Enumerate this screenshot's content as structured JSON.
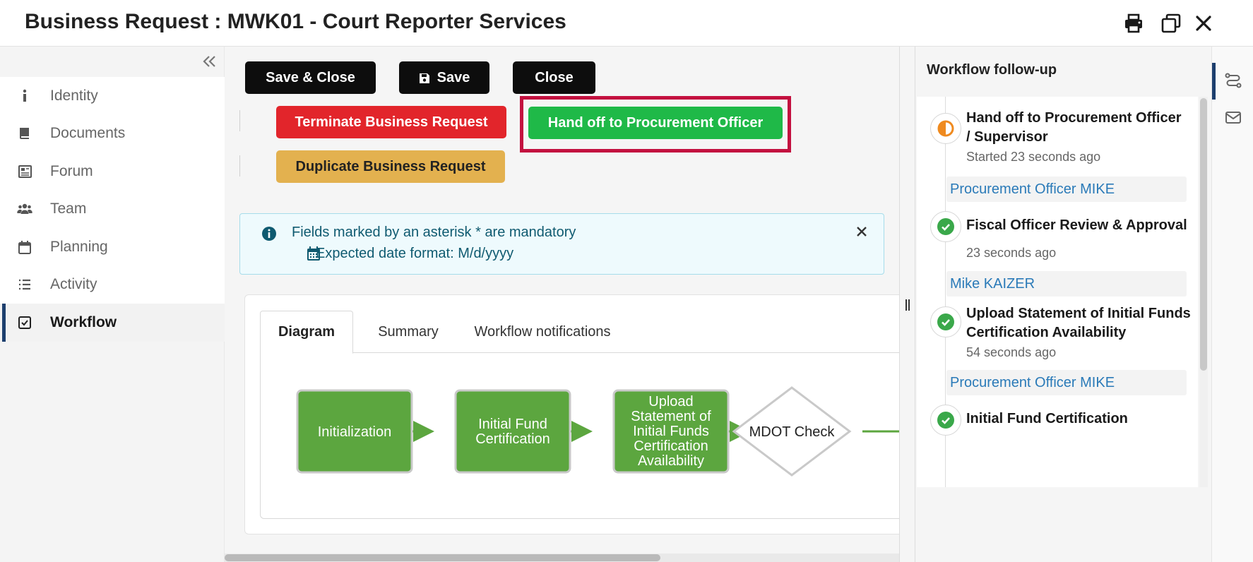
{
  "window": {
    "title": "Business Request : MWK01 - Court Reporter Services"
  },
  "sidebar": {
    "items": [
      {
        "label": "Identity",
        "icon": "info-icon"
      },
      {
        "label": "Documents",
        "icon": "book-icon"
      },
      {
        "label": "Forum",
        "icon": "newspaper-icon"
      },
      {
        "label": "Team",
        "icon": "users-icon"
      },
      {
        "label": "Planning",
        "icon": "calendar-icon"
      },
      {
        "label": "Activity",
        "icon": "list-icon"
      },
      {
        "label": "Workflow",
        "icon": "checkbox-icon",
        "active": true
      }
    ]
  },
  "toolbar": {
    "save_close": "Save & Close",
    "save": "Save",
    "close": "Close",
    "terminate": "Terminate Business Request",
    "handoff": "Hand off to Procurement Officer",
    "duplicate": "Duplicate Business Request"
  },
  "alert": {
    "line1": "Fields marked by an asterisk * are mandatory",
    "line2": "Expected date format: M/d/yyyy"
  },
  "tabs": {
    "diagram": "Diagram",
    "summary": "Summary",
    "notifications": "Workflow notifications"
  },
  "diagram": {
    "nodes": [
      {
        "label": "Initialization",
        "shape": "box"
      },
      {
        "label": "Initial Fund Certification",
        "shape": "box"
      },
      {
        "label": "Upload Statement of Initial Funds Certification Availability",
        "shape": "box"
      },
      {
        "label": "MDOT Check",
        "shape": "diamond"
      }
    ],
    "node_color": "#5ca63f",
    "edge_color": "#5ca63f"
  },
  "workflow_followup": {
    "title": "Workflow follow-up",
    "steps": [
      {
        "title_line1": "Hand off to Procurement Officer",
        "title_line2": "/ Supervisor",
        "time": "Started 23 seconds ago",
        "user": "Procurement Officer MIKE",
        "status": "in-progress"
      },
      {
        "title_line1": "Fiscal Officer Review & Approval",
        "title_line2": "",
        "time": "23 seconds ago",
        "user": "Mike KAIZER",
        "status": "done"
      },
      {
        "title_line1": "Upload Statement of Initial Funds",
        "title_line2": "Certification Availability",
        "time": "54 seconds ago",
        "user": "Procurement Officer MIKE",
        "status": "done"
      },
      {
        "title_line1": "Initial Fund Certification",
        "title_line2": "",
        "time": "",
        "user": "",
        "status": "done"
      }
    ]
  },
  "colors": {
    "accent_navy": "#1d3f6e",
    "done_green": "#3aa84a",
    "progress_orange": "#ef8a1f",
    "highlight_red": "#c3103f",
    "link_blue": "#2a7ab8"
  }
}
